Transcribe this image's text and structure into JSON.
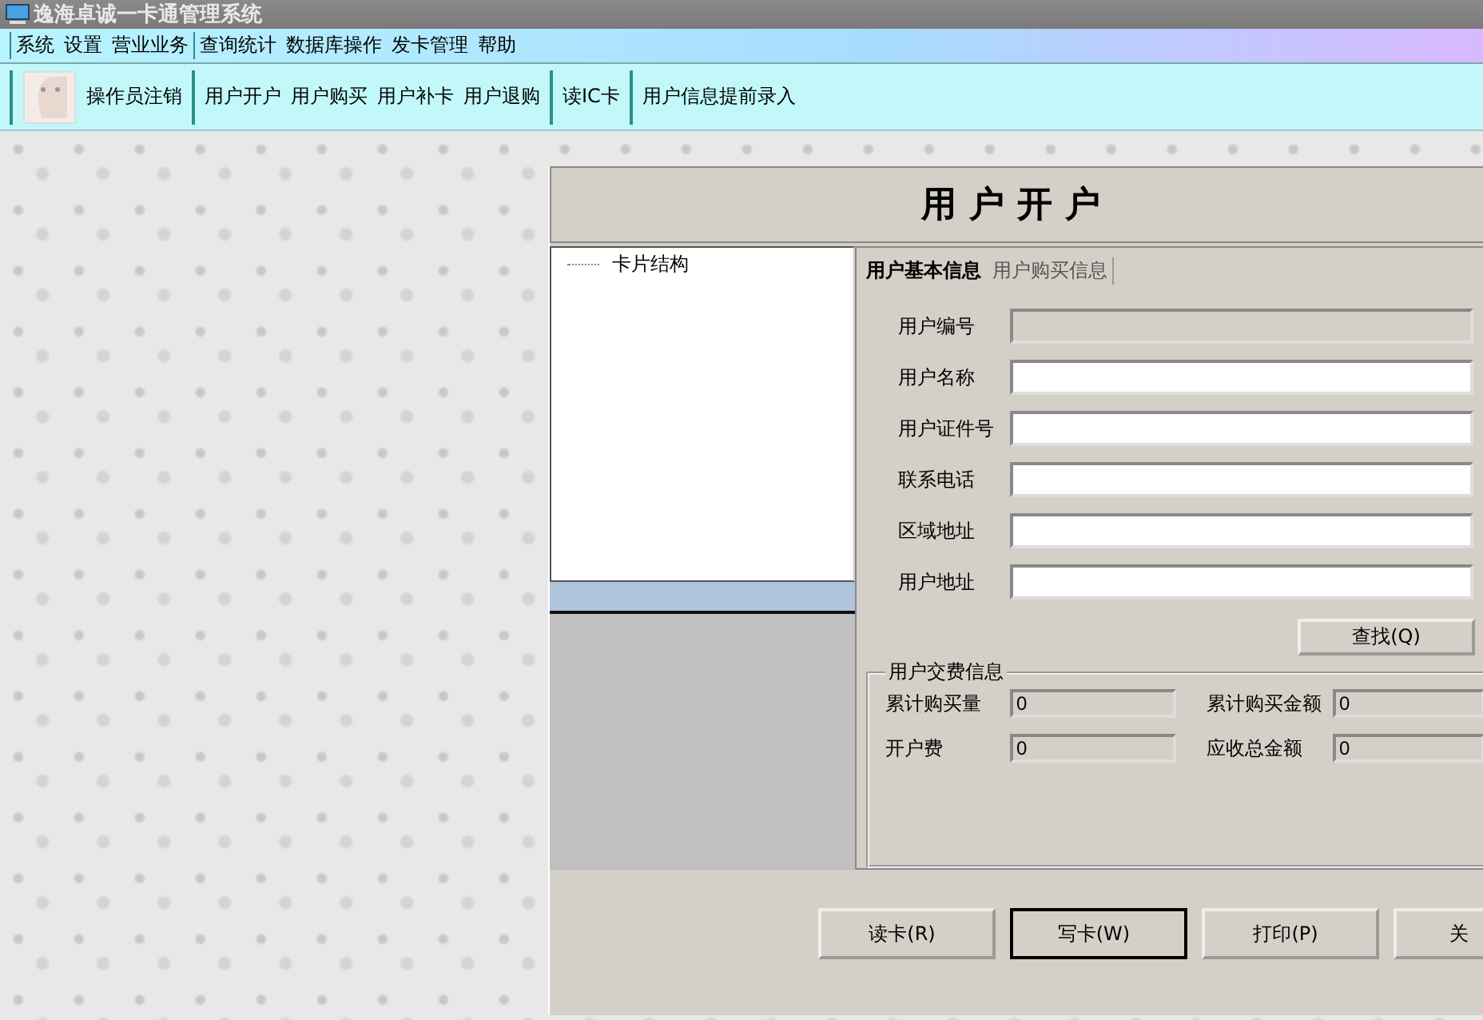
{
  "window": {
    "title": "逸海卓诚一卡通管理系统"
  },
  "menu": [
    {
      "label": "系统",
      "group_start": true
    },
    {
      "label": "设置",
      "group_start": false
    },
    {
      "label": "营业业务",
      "group_start": false
    },
    {
      "label": "查询统计",
      "group_start": true
    },
    {
      "label": "数据库操作",
      "group_start": false
    },
    {
      "label": "发卡管理",
      "group_start": false
    },
    {
      "label": "帮助",
      "group_start": false
    }
  ],
  "toolbar": [
    [
      "操作员注销"
    ],
    [
      "用户开户",
      "用户购买",
      "用户补卡",
      "用户退购"
    ],
    [
      "读IC卡"
    ],
    [
      "用户信息提前录入"
    ]
  ],
  "dialog": {
    "title": "用户开户",
    "tree": [
      {
        "label": "卡片结构"
      }
    ],
    "tabs": [
      {
        "label": "用户基本信息",
        "selected": true
      },
      {
        "label": "用户购买信息",
        "selected": false
      }
    ],
    "fields": [
      {
        "label": "用户编号",
        "disabled": true
      },
      {
        "label": "用户名称",
        "disabled": false
      },
      {
        "label": "用户证件号",
        "disabled": false
      },
      {
        "label": "联系电话",
        "disabled": false
      },
      {
        "label": "区域地址",
        "disabled": false
      },
      {
        "label": "用户地址",
        "disabled": false
      }
    ],
    "search_button": "查找(Q)",
    "fee_group": {
      "title": "用户交费信息",
      "fields": [
        {
          "label": "累计购买量",
          "value": "0"
        },
        {
          "label": "累计购买金额",
          "value": "0"
        },
        {
          "label": "开户费",
          "value": "0"
        },
        {
          "label": "应收总金额",
          "value": "0"
        }
      ]
    },
    "buttons": [
      {
        "label": "读卡(R)",
        "selected": false
      },
      {
        "label": "写卡(W)",
        "selected": true
      },
      {
        "label": "打印(P)",
        "selected": false
      },
      {
        "label": "关",
        "selected": false
      }
    ]
  }
}
